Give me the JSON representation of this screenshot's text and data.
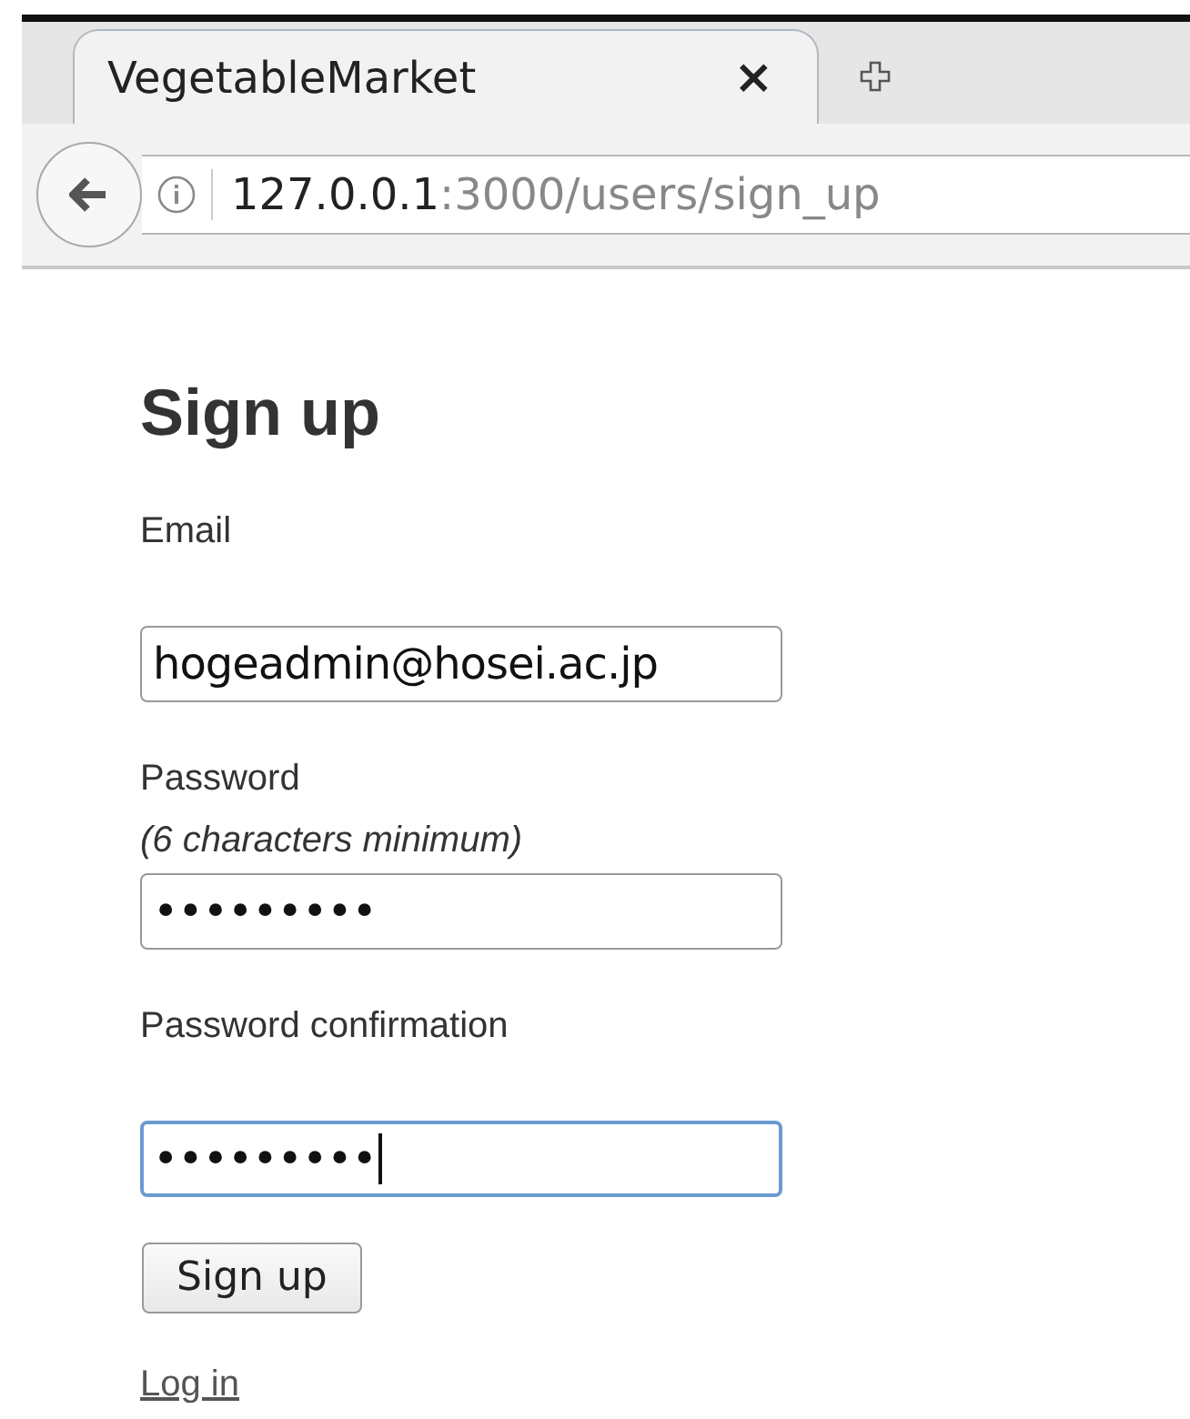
{
  "browser": {
    "tabs": [
      {
        "title": "VegetableMarket",
        "close": "×",
        "selected": true
      }
    ],
    "address": {
      "host": "127.0.0.1",
      "path": ":3000/users/sign_up"
    }
  },
  "form": {
    "title": "Sign up",
    "fields": [
      {
        "label": "Email",
        "value": "hogeadmin@hosei.ac.jp",
        "focused": false
      },
      {
        "label": "Password",
        "hint": "(6 characters minimum)",
        "value": "•••••••••",
        "focused": false
      },
      {
        "label": "Password confirmation",
        "value": "•••••••••",
        "focused": true
      }
    ],
    "submit": "Sign up",
    "link": "Log in"
  }
}
